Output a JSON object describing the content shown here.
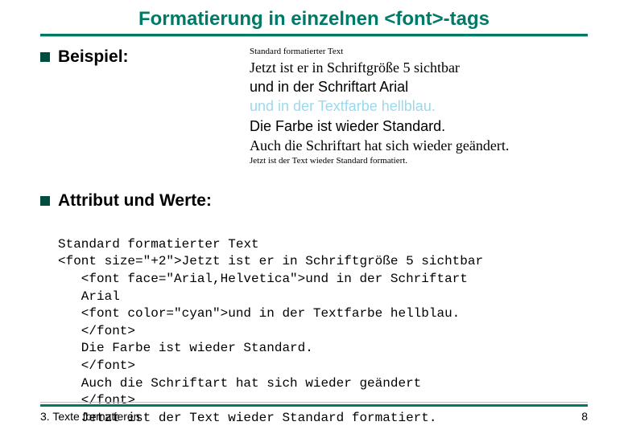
{
  "title": "Formatierung in einzelnen <font>-tags",
  "bullet1": "Beispiel:",
  "bullet2": "Attribut und Werte:",
  "example": {
    "l1": "Standard formatierter Text",
    "l2": "Jetzt ist er in Schriftgröße 5 sichtbar",
    "l3": "und in der Schriftart Arial",
    "l4": "und in der Textfarbe hellblau.",
    "l5": "Die Farbe ist wieder Standard.",
    "l6": "Auch die Schriftart hat sich wieder geändert.",
    "l7": "Jetzt ist der Text wieder Standard formatiert."
  },
  "code": {
    "l1": "Standard formatierter Text",
    "l2": "<font size=\"+2\">Jetzt ist er in Schriftgröße 5 sichtbar",
    "l3": "<font face=\"Arial,Helvetica\">und in der Schriftart",
    "l4": "Arial",
    "l5": "<font color=\"cyan\">und in der Textfarbe hellblau.",
    "l6": "</font>",
    "l7": "Die Farbe ist wieder Standard.",
    "l8": "</font>",
    "l9": "Auch die Schriftart hat sich wieder geändert",
    "l10": "</font>",
    "l11": "Jetzt ist der Text wieder Standard formatiert."
  },
  "footer_left": "3. Texte formatieren",
  "footer_right": "8"
}
